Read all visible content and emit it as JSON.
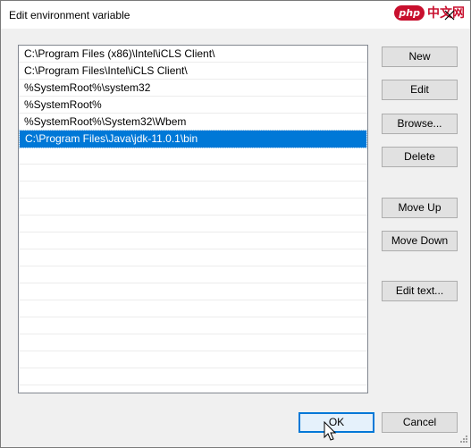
{
  "window": {
    "title": "Edit environment variable",
    "close_glyph": "✕"
  },
  "watermark": {
    "logo": "php",
    "text": "中文网"
  },
  "path_list": {
    "items": [
      "C:\\Program Files (x86)\\Intel\\iCLS Client\\",
      "C:\\Program Files\\Intel\\iCLS Client\\",
      "%SystemRoot%\\system32",
      "%SystemRoot%",
      "%SystemRoot%\\System32\\Wbem",
      "C:\\Program Files\\Java\\jdk-11.0.1\\bin"
    ],
    "selected_index": 5,
    "empty_rows": 14
  },
  "buttons": {
    "new": "New",
    "edit": "Edit",
    "browse": "Browse...",
    "delete": "Delete",
    "move_up": "Move Up",
    "move_down": "Move Down",
    "edit_text": "Edit text...",
    "ok": "OK",
    "cancel": "Cancel"
  },
  "colors": {
    "selection": "#0078d7",
    "watermark": "#c8102e"
  },
  "icons": {
    "close": "close-icon",
    "cursor": "mouse-pointer-icon",
    "grip": "resize-grip-icon"
  }
}
